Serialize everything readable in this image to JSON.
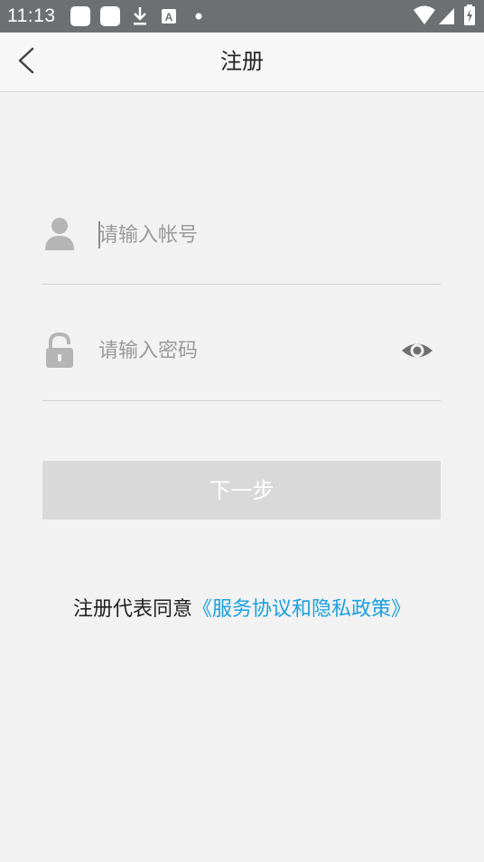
{
  "status_bar": {
    "time": "11:13",
    "icons": [
      "notification-square",
      "notification-square",
      "download-icon",
      "font-icon",
      "dot-icon",
      "wifi-icon",
      "signal-icon",
      "battery-charging-icon"
    ],
    "font_icon_glyph": "A"
  },
  "app_bar": {
    "title": "注册",
    "back_icon": "chevron-left-icon"
  },
  "form": {
    "account": {
      "placeholder": "请输入帐号",
      "value": "",
      "icon": "user-icon"
    },
    "password": {
      "placeholder": "请输入密码",
      "value": "",
      "icon": "lock-icon",
      "toggle_icon": "eye-icon"
    },
    "next_button_label": "下一步"
  },
  "agreement": {
    "prefix": "注册代表同意",
    "link_text": "《服务协议和隐私政策》"
  },
  "colors": {
    "status_bar": "#6d7072",
    "background": "#f2f2f2",
    "link": "#1aa0e0",
    "disabled_button": "#d9d9d9",
    "icon_gray": "#b5b5b5"
  }
}
